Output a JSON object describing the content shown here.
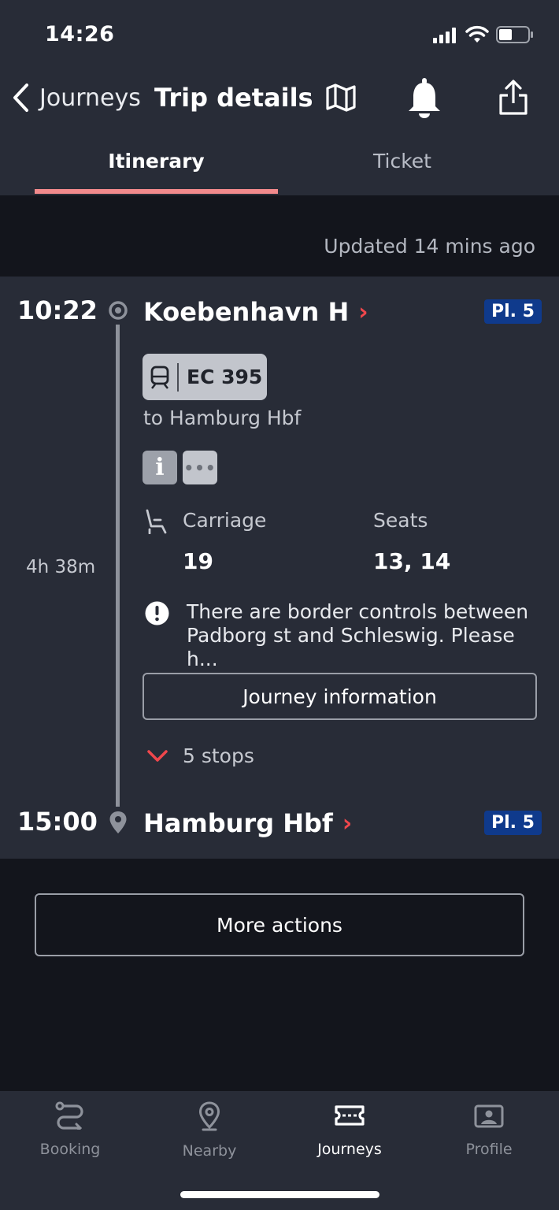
{
  "status_bar": {
    "time": "14:26"
  },
  "header": {
    "back_label": "Journeys",
    "title": "Trip details",
    "icons": [
      "map-icon",
      "bell-icon",
      "share-icon"
    ]
  },
  "tabs": [
    {
      "label": "Itinerary",
      "active": true
    },
    {
      "label": "Ticket",
      "active": false
    }
  ],
  "updated_text": "Updated 14 mins ago",
  "trip": {
    "departure": {
      "time": "10:22",
      "station": "Koebenhavn H",
      "platform": "Pl. 5"
    },
    "train": {
      "label": "EC 395",
      "destination": "to Hamburg Hbf"
    },
    "duration": "4h 38m",
    "seat_info": {
      "carriage_label": "Carriage",
      "carriage_value": "19",
      "seats_label": "Seats",
      "seats_value": "13, 14"
    },
    "notice": "There are border controls between Padborg st and Schleswig. Please h...",
    "journey_info_button": "Journey information",
    "stops_label": "5 stops",
    "arrival": {
      "time": "15:00",
      "station": "Hamburg Hbf",
      "platform": "Pl. 5"
    }
  },
  "more_actions_button": "More actions",
  "bottom_nav": [
    {
      "label": "Booking",
      "icon": "route-icon",
      "active": false
    },
    {
      "label": "Nearby",
      "icon": "location-pin-icon",
      "active": false
    },
    {
      "label": "Journeys",
      "icon": "ticket-icon",
      "active": true
    },
    {
      "label": "Profile",
      "icon": "profile-card-icon",
      "active": false
    }
  ],
  "colors": {
    "background": "#13151c",
    "surface": "#282c37",
    "accent": "#f0474c",
    "tab_underline": "#f28a8c",
    "platform_badge": "#0f3a8c"
  }
}
